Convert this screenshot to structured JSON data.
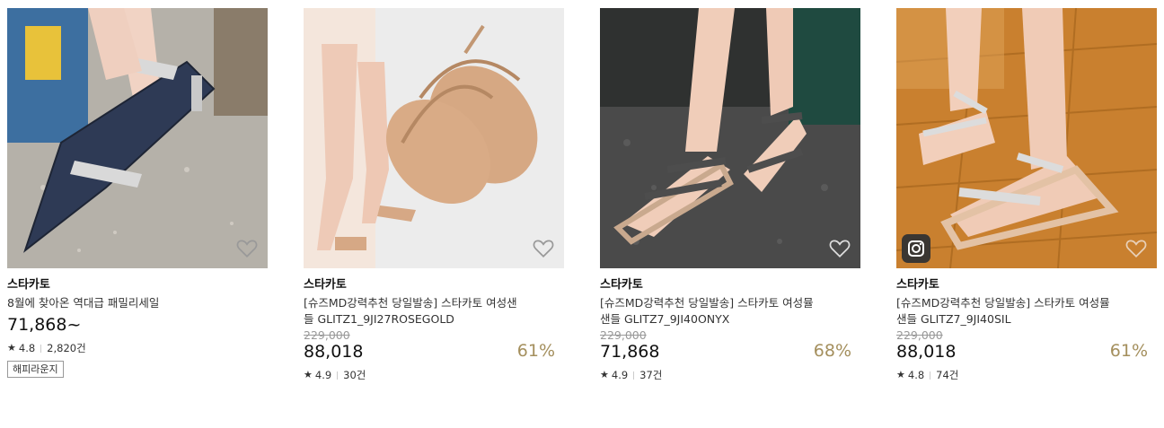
{
  "products": [
    {
      "brand": "스타카토",
      "title_line1": "8월에 찾아온 역대급 패밀리세일",
      "title_line2": "",
      "old_price": "",
      "price": "71,868~",
      "discount": "",
      "rating": "4.8",
      "reviews": "2,820건",
      "tag": "해피라운지"
    },
    {
      "brand": "스타카토",
      "title_line1": "[슈즈MD강력추천 당일발송] 스타카토 여성샌",
      "title_line2": "들 GLITZ1_9JI27ROSEGOLD",
      "old_price": "229,000",
      "price": "88,018",
      "discount": "61%",
      "rating": "4.9",
      "reviews": "30건",
      "tag": ""
    },
    {
      "brand": "스타카토",
      "title_line1": "[슈즈MD강력추천 당일발송] 스타카토 여성뮬",
      "title_line2": "샌들 GLITZ7_9JI40ONYX",
      "old_price": "229,000",
      "price": "71,868",
      "discount": "68%",
      "rating": "4.9",
      "reviews": "37건",
      "tag": ""
    },
    {
      "brand": "스타카토",
      "title_line1": "[슈즈MD강력추천 당일발송] 스타카토 여성뮬",
      "title_line2": "샌들 GLITZ7_9JI40SIL",
      "old_price": "229,000",
      "price": "88,018",
      "discount": "61%",
      "rating": "4.8",
      "reviews": "74건",
      "tag": ""
    }
  ],
  "icons": {
    "star": "★",
    "wishlist": "heart-outline-icon",
    "instagram": "instagram-icon"
  },
  "colors": {
    "discount": "#a48f5d",
    "old_price": "#999999"
  }
}
